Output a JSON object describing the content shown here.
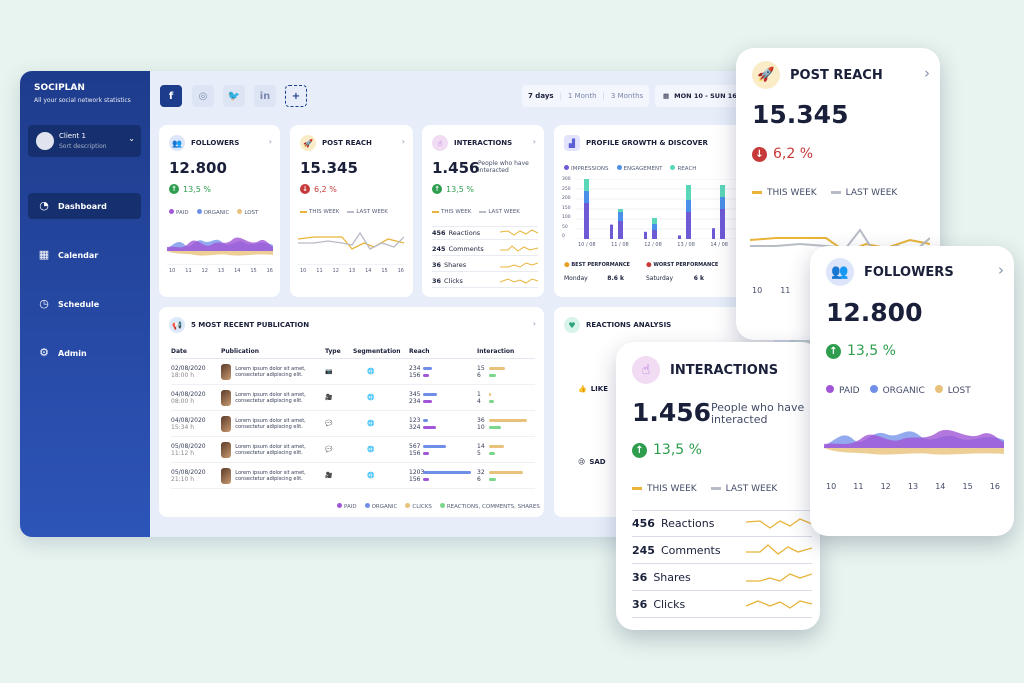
{
  "app": {
    "name": "SOCIPLAN",
    "subtitle": "All your social network statistics"
  },
  "client": {
    "name": "Client 1",
    "description": "Sort description"
  },
  "nav": [
    {
      "label": "Dashboard",
      "icon": "pie-chart-icon"
    },
    {
      "label": "Calendar",
      "icon": "calendar-icon"
    },
    {
      "label": "Schedule",
      "icon": "clock-icon"
    },
    {
      "label": "Admin",
      "icon": "gear-icon"
    }
  ],
  "social": [
    {
      "name": "facebook",
      "glyph": "f"
    },
    {
      "name": "instagram",
      "glyph": "◎"
    },
    {
      "name": "twitter",
      "glyph": "🐦"
    },
    {
      "name": "linkedin",
      "glyph": "in"
    },
    {
      "name": "add",
      "glyph": "+"
    }
  ],
  "range": {
    "options": [
      "7 days",
      "1 Month",
      "3 Months"
    ],
    "selected": "7 days"
  },
  "date": "MON 10 - SUN 16 AUG",
  "followers": {
    "title": "FOLLOWERS",
    "value": "12.800",
    "change": "13,5 %",
    "legend": [
      "PAID",
      "ORGANIC",
      "LOST"
    ],
    "ticks": [
      "10",
      "11",
      "12",
      "13",
      "14",
      "15",
      "16"
    ]
  },
  "reach": {
    "title": "POST REACH",
    "value": "15.345",
    "change": "6,2 %",
    "legend": [
      "THIS WEEK",
      "LAST WEEK"
    ],
    "ticks": [
      "10",
      "11",
      "12",
      "13",
      "14",
      "15",
      "16"
    ]
  },
  "interactions": {
    "title": "INTERACTIONS",
    "value": "1.456",
    "note": "People who have interacted",
    "change": "13,5 %",
    "legend": [
      "THIS WEEK",
      "LAST WEEK"
    ],
    "rows": [
      {
        "n": "456",
        "label": "Reactions"
      },
      {
        "n": "245",
        "label": "Comments"
      },
      {
        "n": "36",
        "label": "Shares"
      },
      {
        "n": "36",
        "label": "Clicks"
      }
    ]
  },
  "growth": {
    "title": "PROFILE GROWTH & DISCOVER",
    "legend": [
      "IMPRESSIONS",
      "ENGAGEMENT",
      "REACH"
    ],
    "yticks": [
      "300",
      "250",
      "200",
      "150",
      "100",
      "50",
      "0"
    ],
    "xticks": [
      "10 / 08",
      "11 / 08",
      "12 / 08",
      "13 / 08",
      "14 / 08"
    ],
    "best_label": "BEST PERFORMANCE",
    "best_day": "Monday",
    "best_value": "8.6 k",
    "worst_label": "WORST PERFORMANCE",
    "worst_day": "Saturday",
    "worst_value": "6 k"
  },
  "publications": {
    "title": "5 MOST RECENT PUBLICATION",
    "headers": [
      "Date",
      "Publication",
      "Type",
      "Segmentation",
      "Reach",
      "Interaction"
    ],
    "rows": [
      {
        "date": "02/08/2020",
        "time": "18:00 h",
        "text": "Lorem ipsum dolor sit amet, consectetur adipiscing elit.",
        "type": "camera",
        "reach": [
          "234",
          "156"
        ],
        "inter": [
          "15",
          "6"
        ]
      },
      {
        "date": "04/08/2020",
        "time": "08:00 h",
        "text": "Lorem ipsum dolor sit amet, consectetur adipiscing elit.",
        "type": "video",
        "reach": [
          "345",
          "234"
        ],
        "inter": [
          "1",
          "4"
        ]
      },
      {
        "date": "04/08/2020",
        "time": "15:34 h",
        "text": "Lorem ipsum dolor sit amet, consectetur adipiscing elit.",
        "type": "chat",
        "reach": [
          "123",
          "324"
        ],
        "inter": [
          "36",
          "10"
        ]
      },
      {
        "date": "05/08/2020",
        "time": "11:12 h",
        "text": "Lorem ipsum dolor sit amet, consectetur adipiscing elit.",
        "type": "chat",
        "reach": [
          "567",
          "156"
        ],
        "inter": [
          "14",
          "5"
        ]
      },
      {
        "date": "05/08/2020",
        "time": "21:10 h",
        "text": "Lorem ipsum dolor sit amet, consectetur adipiscing elit.",
        "type": "video",
        "reach": [
          "1203",
          "156"
        ],
        "inter": [
          "32",
          "6"
        ]
      }
    ],
    "legend": [
      "PAID",
      "ORGANIC",
      "CLICKS",
      "REACTIONS, COMMENTS, SHARES"
    ]
  },
  "reactions": {
    "title": "REACTIONS ANALYSIS",
    "items": [
      "LIKE",
      "SAD"
    ]
  },
  "colors": {
    "sidebar": "#1e3c8c",
    "green": "#2e9e4e",
    "red": "#c73a3a",
    "purple": "#a056d6",
    "blue": "#6f8ee8",
    "gold": "#e8b43a",
    "gray": "#b8bcc6"
  }
}
